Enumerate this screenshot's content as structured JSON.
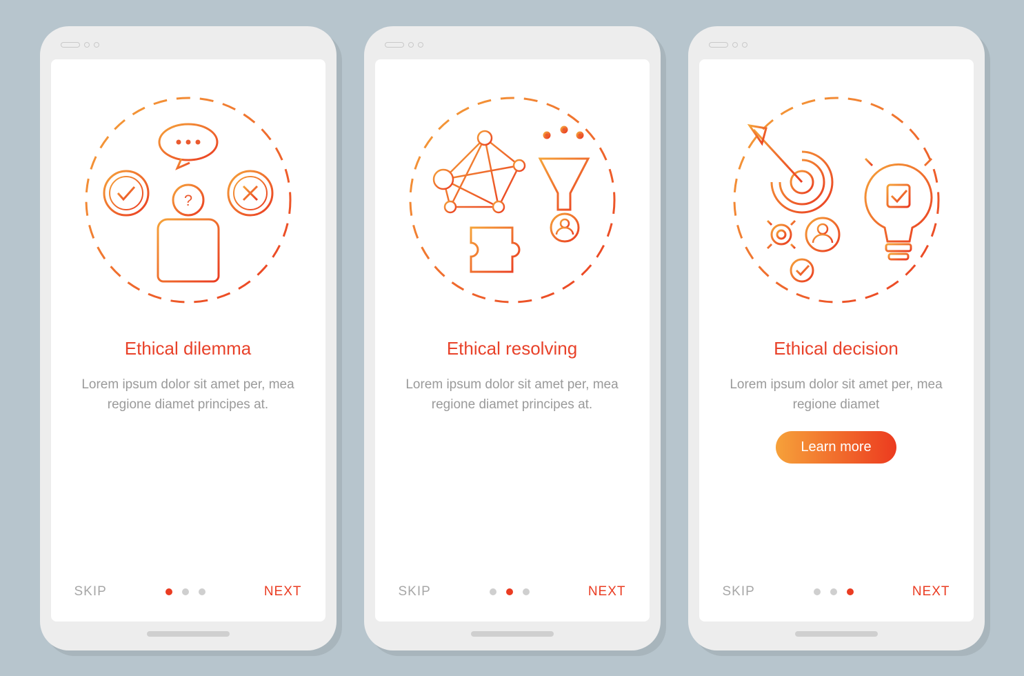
{
  "common": {
    "skip_label": "SKIP",
    "next_label": "NEXT",
    "colors": {
      "accent_start": "#f6a13a",
      "accent_end": "#ec3b1f",
      "muted": "#9a9a9a"
    }
  },
  "screens": [
    {
      "title": "Ethical dilemma",
      "description": "Lorem ipsum dolor sit amet per, mea regione diamet principes at.",
      "illustration": "dilemma-illustration",
      "active_dot": 0,
      "cta_label": null
    },
    {
      "title": "Ethical resolving",
      "description": "Lorem ipsum dolor sit amet per, mea regione diamet principes at.",
      "illustration": "resolving-illustration",
      "active_dot": 1,
      "cta_label": null
    },
    {
      "title": "Ethical decision",
      "description": "Lorem ipsum dolor sit amet per, mea regione diamet",
      "illustration": "decision-illustration",
      "active_dot": 2,
      "cta_label": "Learn more"
    }
  ]
}
